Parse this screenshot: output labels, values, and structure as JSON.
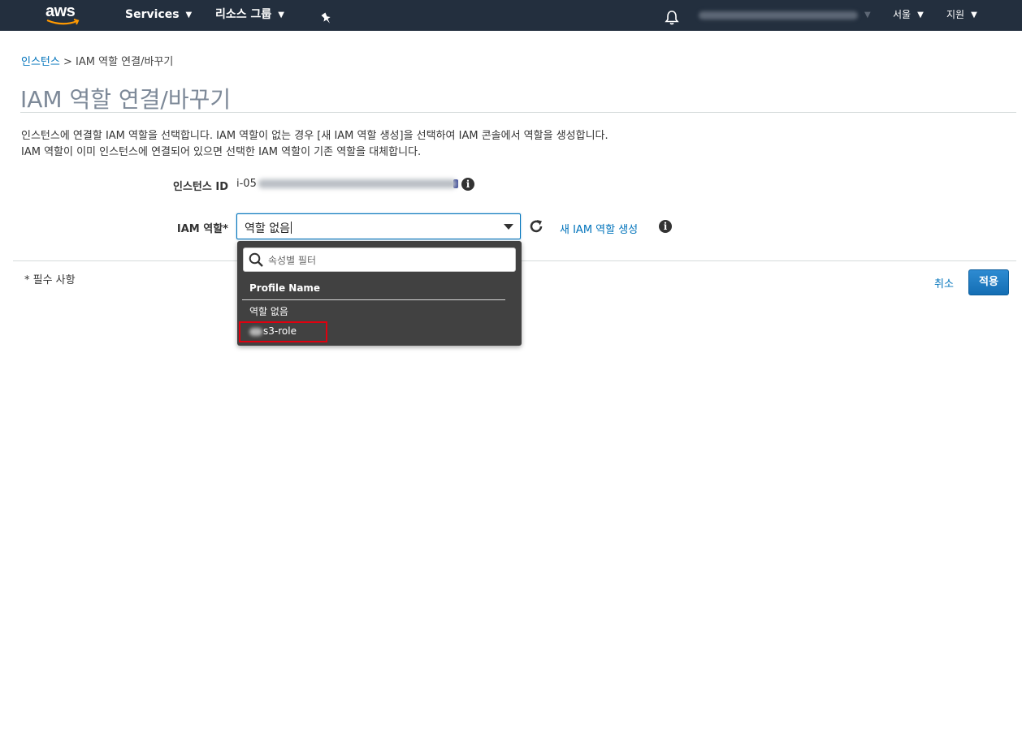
{
  "nav": {
    "logo": "aws",
    "services": "Services",
    "resource_groups": "리소스 그룹",
    "region": "서울",
    "support": "지원"
  },
  "breadcrumb": {
    "parent": "인스턴스",
    "separator": ">",
    "current": "IAM 역할 연결/바꾸기"
  },
  "page": {
    "title": "IAM 역할 연결/바꾸기",
    "description_line1": "인스턴스에 연결할 IAM 역할을 선택합니다. IAM 역할이 없는 경우 [새 IAM 역할 생성]을 선택하여 IAM 콘솔에서 역할을 생성합니다.",
    "description_line2": "IAM 역할이 이미 인스턴스에 연결되어 있으면 선택한 IAM 역할이 기존 역할을 대체합니다."
  },
  "form": {
    "instance_id_label": "인스턴스 ID",
    "instance_id_prefix": "i-05",
    "iam_role_label": "IAM 역할*",
    "iam_role_value": "역할 없음",
    "new_role_link": "새 IAM 역할 생성"
  },
  "dropdown": {
    "filter_placeholder": "속성별 필터",
    "header": "Profile Name",
    "items": [
      "역할 없음",
      "s3-role"
    ]
  },
  "footer": {
    "required_note": "* 필수 사항",
    "cancel": "취소",
    "apply": "적용"
  },
  "colors": {
    "nav_bg": "#232f3e",
    "link": "#0073bb",
    "primary_button": "#146eb4",
    "dropdown_bg": "#414141",
    "highlight": "#e0000f",
    "title": "#7d8998"
  },
  "icons": [
    "bell-icon",
    "pin-icon",
    "info-icon",
    "refresh-icon",
    "search-icon",
    "caret-down-icon"
  ]
}
